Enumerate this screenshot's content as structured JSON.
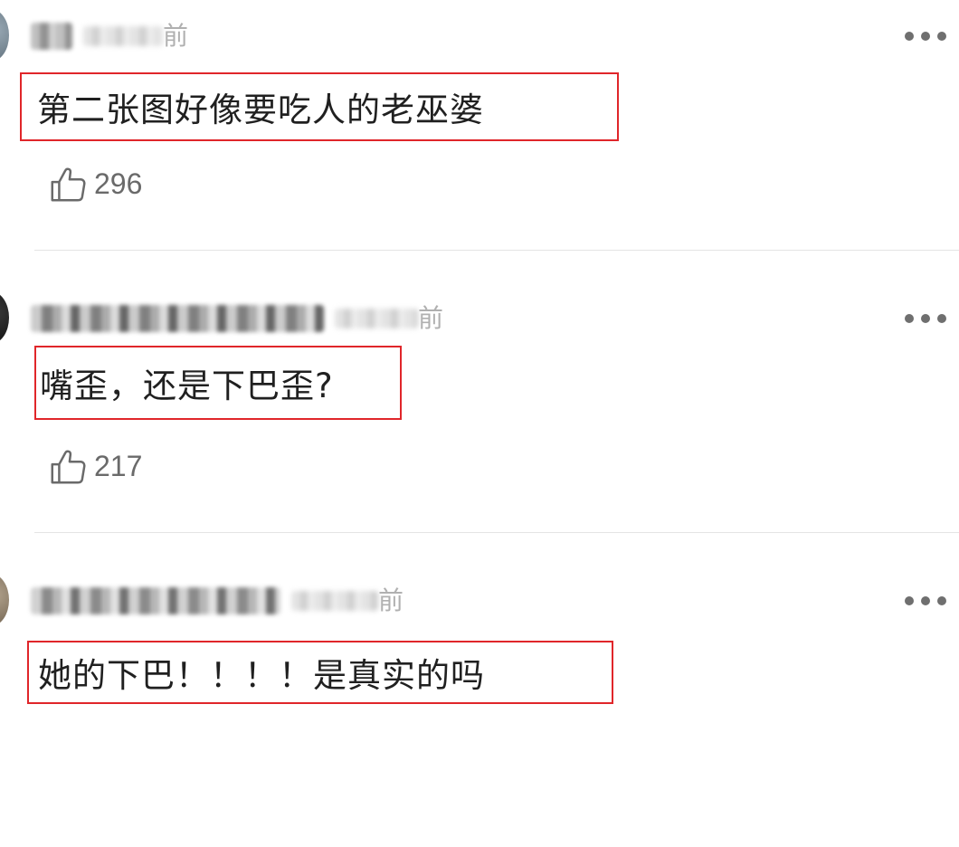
{
  "comments": [
    {
      "time_suffix": "前",
      "text": "第二张图好像要吃人的老巫婆",
      "likes": "296",
      "avatar_color": "#6e7f8a"
    },
    {
      "time_suffix": "前",
      "text": "嘴歪，还是下巴歪?",
      "likes": "217",
      "avatar_color": "#1c1c1c"
    },
    {
      "time_suffix": "前",
      "text": "她的下巴！！！！是真实的吗",
      "avatar_color": "#8a7a66"
    }
  ],
  "icons": {
    "more": "more-dots-icon",
    "like": "thumbs-up-icon"
  },
  "colors": {
    "highlight_box": "#e0262a",
    "divider": "#e4e4e4",
    "muted_text": "#6a6a6a"
  }
}
